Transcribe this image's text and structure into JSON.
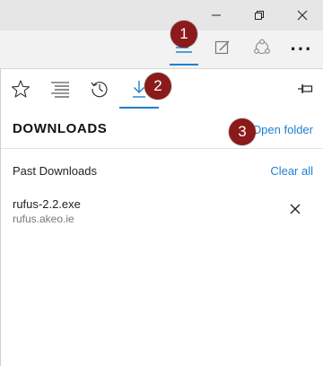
{
  "window": {
    "minimize_icon": "minimize-icon",
    "restore_icon": "restore-icon",
    "close_icon": "close-icon"
  },
  "toolbar": {
    "hub_icon": "hub-icon",
    "web_note_icon": "web-note-icon",
    "share_icon": "share-icon",
    "more_icon": "more-icon",
    "more_label": "···",
    "active_color": "#1f7fd0"
  },
  "hub_tabs": [
    {
      "id": "favorites",
      "icon": "star-icon"
    },
    {
      "id": "reading-list",
      "icon": "reading-list-icon"
    },
    {
      "id": "history",
      "icon": "history-icon"
    },
    {
      "id": "downloads",
      "icon": "download-icon",
      "active": true
    }
  ],
  "callouts": {
    "one": "1",
    "two": "2",
    "three": "3"
  },
  "downloads": {
    "title": "DOWNLOADS",
    "open_folder": "Open folder",
    "past_label": "Past Downloads",
    "clear_all": "Clear all",
    "items": [
      {
        "name": "rufus-2.2.exe",
        "source": "rufus.akeo.ie"
      }
    ]
  },
  "colors": {
    "link": "#1f7fd0",
    "callout": "#8b1a1a",
    "titlebar": "#e6e6e6",
    "toolbar": "#f2f2f2",
    "panel": "#ffffff"
  }
}
